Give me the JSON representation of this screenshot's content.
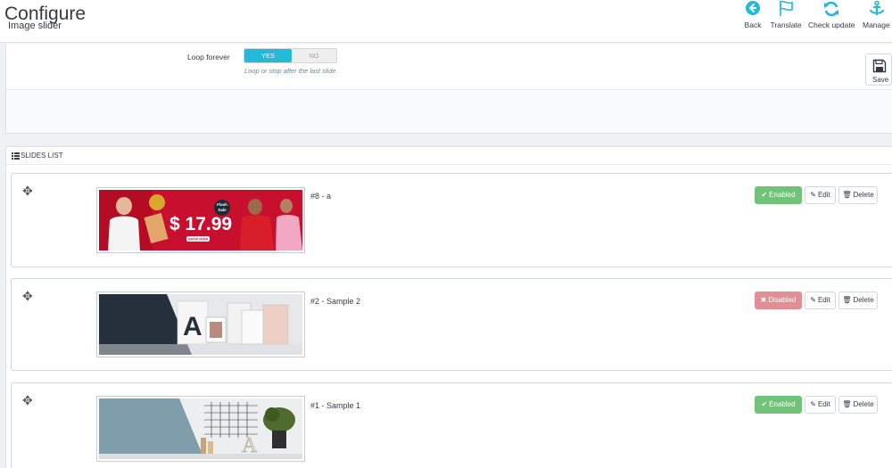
{
  "header": {
    "title": "Configure",
    "subtitle": "Image slider",
    "toolbar": [
      {
        "label": "Back",
        "icon": "back-arrow-icon"
      },
      {
        "label": "Translate",
        "icon": "flag-icon"
      },
      {
        "label": "Check update",
        "icon": "refresh-icon"
      },
      {
        "label": "Manage h",
        "icon": "anchor-icon"
      }
    ]
  },
  "form": {
    "loop_label": "Loop forever",
    "yes_label": "YES",
    "no_label": "NO",
    "selected": "YES",
    "help_text": "Loop or stop after the last slide.",
    "save_label": "Save"
  },
  "slides_list": {
    "heading": "SLIDES LIST",
    "items": [
      {
        "title": "#8 - a",
        "status": "Enabled",
        "status_enabled": true,
        "edit_label": "Edit",
        "delete_label": "Delete",
        "image": {
          "type": "promo-banner",
          "text": {
            "badge": "Flash Sale",
            "price": "$ 17.99",
            "cta": "SHOP NOW"
          }
        }
      },
      {
        "title": "#2 - Sample 2",
        "status": "Disabled",
        "status_enabled": false,
        "edit_label": "Edit",
        "delete_label": "Delete",
        "image": {
          "type": "sample-banner-2"
        }
      },
      {
        "title": "#1 - Sample 1",
        "status": "Enabled",
        "status_enabled": true,
        "edit_label": "Edit",
        "delete_label": "Delete",
        "image": {
          "type": "sample-banner-1"
        }
      }
    ]
  },
  "colors": {
    "accent": "#25b9d7",
    "enabled": "#72c279",
    "disabled": "#e08f95",
    "banner_red": "#c8102e",
    "sample_dark": "#25303a",
    "sample_blue": "#7f9daa"
  }
}
